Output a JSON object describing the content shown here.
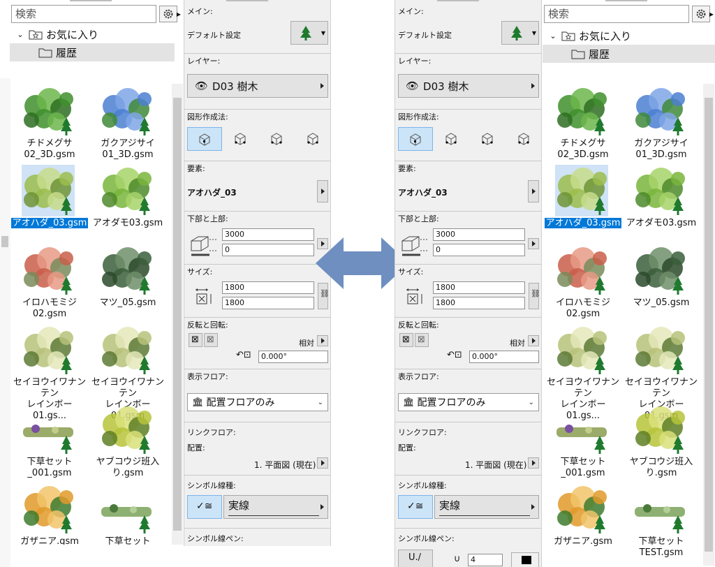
{
  "library": {
    "search_placeholder": "検索",
    "favorites": "お気に入り",
    "history": "履歴",
    "left_items": [
      {
        "label": "チドメグサ\n02_3D.gsm",
        "selected": false
      },
      {
        "label": "ガクアジサイ\n01_3D.gsm",
        "selected": false
      },
      {
        "label": "アオハダ_03.gsm",
        "selected": true
      },
      {
        "label": "アオダモ03.gsm",
        "selected": false
      },
      {
        "label": "イロハモミジ\n02.gsm",
        "selected": false
      },
      {
        "label": "マツ_05.gsm",
        "selected": false
      },
      {
        "label": "セイヨウイワナンテン\nレインボー01.gs...",
        "selected": false
      },
      {
        "label": "セイヨウイワナンテン\nレインボー01.gsm",
        "selected": false
      },
      {
        "label": "下草セット\n_001.gsm",
        "selected": false
      },
      {
        "label": "ヤブコウジ班入\nり.gsm",
        "selected": false
      },
      {
        "label": "ガザニア.gsm",
        "selected": false
      },
      {
        "label": "下草セット",
        "selected": false
      }
    ],
    "right_items": [
      {
        "label": "チドメグサ\n02_3D.gsm",
        "selected": false
      },
      {
        "label": "ガクアジサイ\n01_3D.gsm",
        "selected": false
      },
      {
        "label": "アオハダ_03.gsm",
        "selected": true
      },
      {
        "label": "アオダモ03.gsm",
        "selected": false
      },
      {
        "label": "イロハモミジ\n02.gsm",
        "selected": false
      },
      {
        "label": "マツ_05.gsm",
        "selected": false
      },
      {
        "label": "セイヨウイワナンテン\nレインボー01.gs...",
        "selected": false
      },
      {
        "label": "セイヨウイワナンテン\nレインボー01.gsm",
        "selected": false
      },
      {
        "label": "下草セット\n_001.gsm",
        "selected": false
      },
      {
        "label": "ヤブコウジ班入\nり.gsm",
        "selected": false
      },
      {
        "label": "ガザニア.gsm",
        "selected": false
      },
      {
        "label": "下草セット\nTEST.gsm",
        "selected": false
      }
    ]
  },
  "settings": {
    "main_label": "メイン:",
    "default_label": "デフォルト設定",
    "layer_label": "レイヤー:",
    "layer_value": "D03 樹木",
    "geometry_label": "図形作成法:",
    "element_label": "要素:",
    "element_value": "アオハダ_03",
    "bottom_top_label": "下部と上部:",
    "top_value": "3000",
    "bottom_value": "0",
    "size_label": "サイズ:",
    "width_value": "1800",
    "depth_value": "1800",
    "flip_label": "反転と回転:",
    "relative_label": "相対",
    "angle_value": "0.000°",
    "floor_label": "表示フロア:",
    "floor_value": "配置フロアのみ",
    "link_floor_label": "リンクフロア:",
    "placement_label": "配置:",
    "placement_value": "1. 平面図 (現在)",
    "symbol_line_label": "シンボル線種:",
    "line_value": "実線",
    "symbol_pen_label": "シンボル線ペン:",
    "pen_value": "4"
  },
  "colors": {
    "arrow": "#6e8fc0",
    "selection": "#0078d7"
  }
}
